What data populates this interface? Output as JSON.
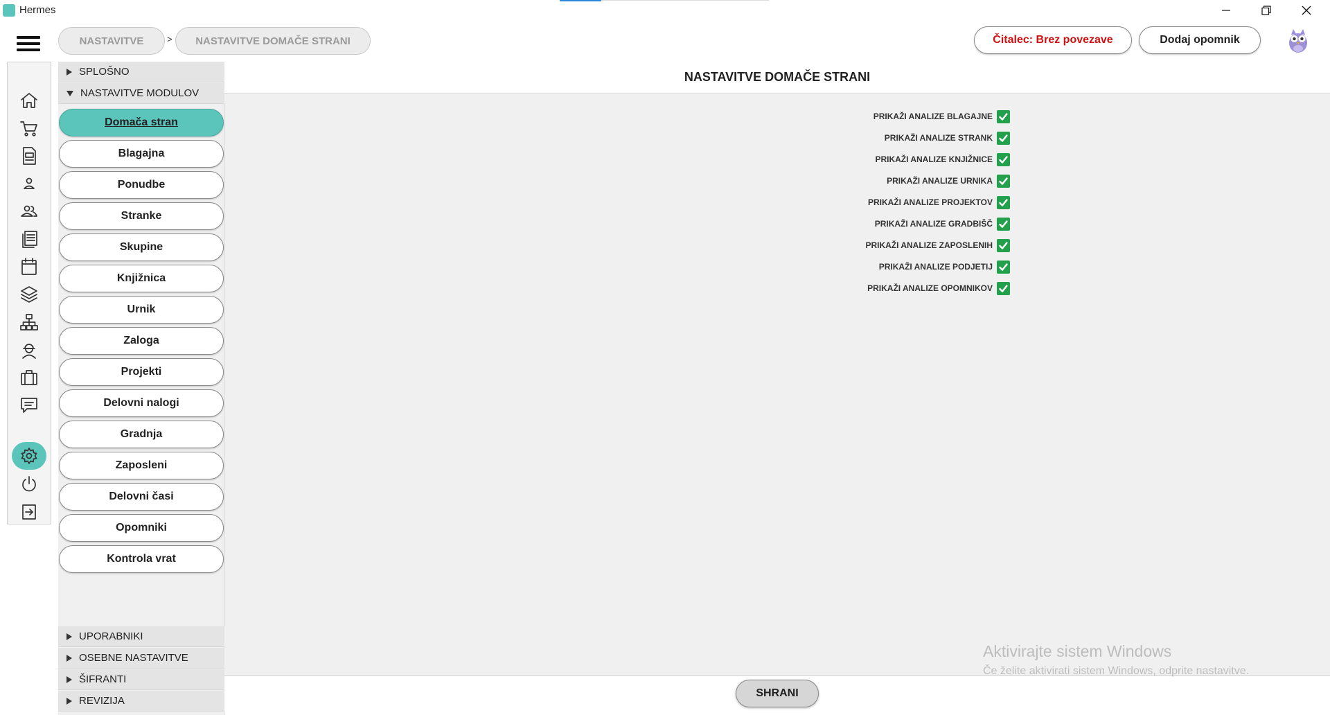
{
  "window": {
    "title": "Hermes"
  },
  "breadcrumb": {
    "items": [
      "NASTAVITVE",
      "NASTAVITVE DOMAČE STRANI"
    ],
    "separator": ">"
  },
  "header": {
    "reader_status": "Čitalec: Brez povezave",
    "add_reminder": "Dodaj opomnik"
  },
  "colors": {
    "accent": "#5bc4bb",
    "reader_status_text": "#d01010",
    "checkbox": "#22a04b"
  },
  "sidebar_icons": [
    "home-icon",
    "cart-icon",
    "invoice-icon",
    "user-icon",
    "users-icon",
    "documents-icon",
    "calendar-icon",
    "layers-icon",
    "network-icon",
    "worker-icon",
    "briefcase-icon",
    "chat-icon",
    "gear-icon",
    "power-icon",
    "logout-icon"
  ],
  "left_panel": {
    "sections_top": [
      "SPLOŠNO",
      "NASTAVITVE MODULOV"
    ],
    "modules": [
      "Domača stran",
      "Blagajna",
      "Ponudbe",
      "Stranke",
      "Skupine",
      "Knjižnica",
      "Urnik",
      "Zaloga",
      "Projekti",
      "Delovni nalogi",
      "Gradnja",
      "Zaposleni",
      "Delovni časi",
      "Opomniki",
      "Kontrola vrat"
    ],
    "active_module": "Domača stran",
    "sections_bottom": [
      "UPORABNIKI",
      "OSEBNE NASTAVITVE",
      "ŠIFRANTI",
      "REVIZIJA"
    ]
  },
  "main": {
    "title": "NASTAVITVE DOMAČE STRANI",
    "options": [
      {
        "label": "PRIKAŽI ANALIZE BLAGAJNE",
        "checked": true
      },
      {
        "label": "PRIKAŽI ANALIZE STRANK",
        "checked": true
      },
      {
        "label": "PRIKAŽI ANALIZE KNJIŽNICE",
        "checked": true
      },
      {
        "label": "PRIKAŽI ANALIZE URNIKA",
        "checked": true
      },
      {
        "label": "PRIKAŽI ANALIZE PROJEKTOV",
        "checked": true
      },
      {
        "label": "PRIKAŽI ANALIZE GRADBIŠČ",
        "checked": true
      },
      {
        "label": "PRIKAŽI ANALIZE ZAPOSLENIH",
        "checked": true
      },
      {
        "label": "PRIKAŽI ANALIZE PODJETIJ",
        "checked": true
      },
      {
        "label": "PRIKAŽI ANALIZE OPOMNIKOV",
        "checked": true
      }
    ],
    "save_label": "SHRANI"
  },
  "watermark": {
    "line1": "Aktivirajte sistem Windows",
    "line2": "Če želite aktivirati sistem Windows, odprite nastavitve."
  }
}
